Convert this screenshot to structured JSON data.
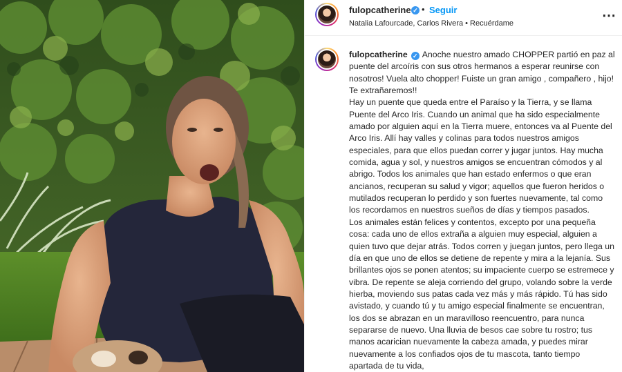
{
  "post": {
    "username": "fulopcatherine",
    "follow_label": "Seguir",
    "separator": "•",
    "audio_line": "Natalia Lafourcade, Carlos Rivera • Recuérdame",
    "more_label": "⋯",
    "verified_glyph": "✓"
  },
  "caption": {
    "username": "fulopcatherine",
    "paragraphs": [
      "Anoche nuestro amado CHOPPER partió en paz al puente del arcoíris con sus otros hermanos a esperar reunirse con nosotros! Vuela alto chopper! Fuiste un gran amigo , compañero , hijo! Te extrañaremos!!",
      "Hay un puente que queda entre el Paraíso y la Tierra, y se llama Puente del Arco Iris. Cuando un animal que ha sido especialmente amado por alguien aquí en la Tierra muere, entonces va al Puente del Arco Iris. Allí hay valles y colinas para todos nuestros amigos especiales, para que ellos puedan correr y jugar juntos. Hay mucha comida, agua y sol, y nuestros amigos se encuentran cómodos y al abrigo. Todos los animales que han estado enfermos o que eran ancianos, recuperan su salud y vigor; aquellos que fueron heridos o mutilados recuperan lo perdido y son fuertes nuevamente, tal como los recordamos en nuestros sueños de días y tiempos pasados.",
      "Los animales están felices y contentos, excepto por una pequeña cosa: cada uno de ellos extraña a alguien muy especial, alguien a quien tuvo que dejar atrás. Todos corren y juegan juntos, pero llega un día en que uno de ellos se detiene de repente y mira a la lejanía. Sus brillantes ojos se ponen atentos; su impaciente cuerpo se estremece y vibra. De repente se aleja corriendo del grupo, volando sobre la verde hierba, moviendo sus patas cada vez más y más rápido. Tú has sido avistado, y cuando tú y tu amigo especial finalmente se encuentran, los dos se abrazan en un maravilloso reencuentro, para nunca separarse de nuevo. Una lluvia de besos cae sobre tu rostro; tus manos acarician nuevamente la cabeza amada, y puedes mirar nuevamente a los confiados ojos de tu mascota, tanto tiempo apartada de tu vida,"
    ]
  },
  "colors": {
    "link_blue": "#0095f6",
    "verified_blue": "#3897f0",
    "text": "#262626"
  }
}
